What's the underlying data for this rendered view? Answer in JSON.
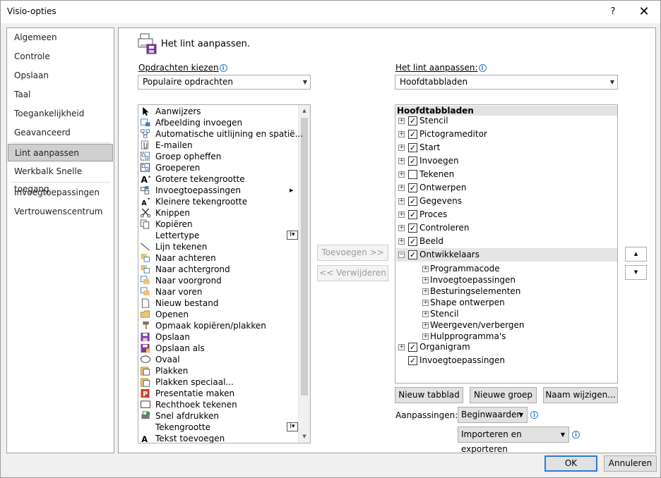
{
  "window": {
    "title": "Visio-opties",
    "help_label": "?",
    "close_label": "✕"
  },
  "nav": {
    "items": [
      {
        "label": "Algemeen"
      },
      {
        "label": "Controle"
      },
      {
        "label": "Opslaan"
      },
      {
        "label": "Taal"
      },
      {
        "label": "Toegankelijkheid"
      },
      {
        "label": "Geavanceerd"
      },
      {
        "label": "Lint aanpassen",
        "selected": true
      },
      {
        "label": "Werkbalk Snelle toegang"
      },
      {
        "label": "Invoegtoepassingen"
      },
      {
        "label": "Vertrouwenscentrum"
      }
    ]
  },
  "header": {
    "title": "Het lint aanpassen."
  },
  "commands": {
    "label": "Opdrachten kiezen",
    "selected": "Populaire opdrachten",
    "items": [
      {
        "label": "Aanwijzers",
        "icon": "pointer-icon"
      },
      {
        "label": "Afbeelding invoegen",
        "icon": "picture-icon"
      },
      {
        "label": "Automatische uitlijning en spatië...",
        "icon": "autoalign-icon"
      },
      {
        "label": "E-mailen",
        "icon": "attach-icon"
      },
      {
        "label": "Groep opheffen",
        "icon": "ungroup-icon"
      },
      {
        "label": "Groeperen",
        "icon": "group-icon"
      },
      {
        "label": "Grotere tekengrootte",
        "icon": "grow-font-icon"
      },
      {
        "label": "Invoegtoepassingen",
        "icon": "addins-icon",
        "submenu": true
      },
      {
        "label": "Kleinere tekengrootte",
        "icon": "shrink-font-icon"
      },
      {
        "label": "Knippen",
        "icon": "scissors-icon"
      },
      {
        "label": "Kopiëren",
        "icon": "copy-icon"
      },
      {
        "label": "Lettertype",
        "icon": "",
        "fontbox": true
      },
      {
        "label": "Lijn tekenen",
        "icon": "line-icon"
      },
      {
        "label": "Naar achteren",
        "icon": "send-backward-icon"
      },
      {
        "label": "Naar achtergrond",
        "icon": "send-to-back-icon"
      },
      {
        "label": "Naar voorgrond",
        "icon": "bring-to-front-icon"
      },
      {
        "label": "Naar voren",
        "icon": "bring-forward-icon"
      },
      {
        "label": "Nieuw bestand",
        "icon": "new-file-icon"
      },
      {
        "label": "Openen",
        "icon": "folder-icon"
      },
      {
        "label": "Opmaak kopiëren/plakken",
        "icon": "format-painter-icon"
      },
      {
        "label": "Opslaan",
        "icon": "save-icon"
      },
      {
        "label": "Opslaan als",
        "icon": "save-as-icon"
      },
      {
        "label": "Ovaal",
        "icon": "ellipse-icon"
      },
      {
        "label": "Plakken",
        "icon": "paste-icon"
      },
      {
        "label": "Plakken speciaal...",
        "icon": "paste-special-icon"
      },
      {
        "label": "Presentatie maken",
        "icon": "powerpoint-icon"
      },
      {
        "label": "Rechthoek tekenen",
        "icon": "rectangle-icon"
      },
      {
        "label": "Snel afdrukken",
        "icon": "quick-print-icon"
      },
      {
        "label": "Tekengrootte",
        "icon": "",
        "fontbox": true
      },
      {
        "label": "Tekst toevoegen",
        "icon": "text-icon"
      }
    ]
  },
  "mid": {
    "add_label": "Toevoegen >>",
    "remove_label": "<< Verwijderen"
  },
  "ribbon": {
    "label": "Het lint aanpassen:",
    "selected": "Hoofdtabbladen",
    "tree_header": "Hoofdtabbladen",
    "tabs": [
      {
        "label": "Stencil",
        "checked": true,
        "expanded": false
      },
      {
        "label": "Pictogrameditor",
        "checked": true,
        "expanded": false
      },
      {
        "label": "Start",
        "checked": true,
        "expanded": false
      },
      {
        "label": "Invoegen",
        "checked": true,
        "expanded": false
      },
      {
        "label": "Tekenen",
        "checked": false,
        "expanded": false
      },
      {
        "label": "Ontwerpen",
        "checked": true,
        "expanded": false
      },
      {
        "label": "Gegevens",
        "checked": true,
        "expanded": false
      },
      {
        "label": "Proces",
        "checked": true,
        "expanded": false
      },
      {
        "label": "Controleren",
        "checked": true,
        "expanded": false
      },
      {
        "label": "Beeld",
        "checked": true,
        "expanded": false
      },
      {
        "label": "Ontwikkelaars",
        "checked": true,
        "expanded": true,
        "selected": true
      }
    ],
    "developer_groups": [
      "Programmacode",
      "Invoegtoepassingen",
      "Besturingselementen",
      "Shape ontwerpen",
      "Stencil",
      "Weergeven/verbergen",
      "Hulpprogramma's"
    ],
    "tail": [
      {
        "label": "Organigram",
        "checked": true,
        "expandable": true
      },
      {
        "label": "Invoegtoepassingen",
        "checked": true,
        "expandable": false
      }
    ],
    "new_tab_label": "Nieuw tabblad",
    "new_group_label": "Nieuwe groep",
    "rename_label": "Naam wijzigen...",
    "customizations_label": "Aanpassingen:",
    "reset_label": "Beginwaarden",
    "import_export_label": "Importeren en exporteren"
  },
  "footer": {
    "ok_label": "OK",
    "cancel_label": "Annuleren"
  },
  "colors": {
    "accent": "#2b7cd3",
    "selected_nav": "#cfcfcf"
  }
}
